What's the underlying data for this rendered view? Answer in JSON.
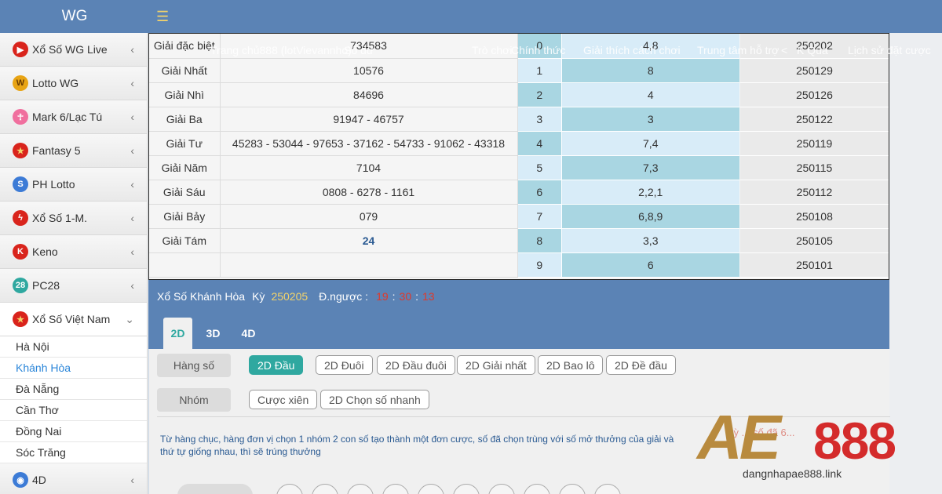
{
  "app": {
    "brand": "WG",
    "menu_icon": "hamburger-icon"
  },
  "nav": [
    "Trang chủ888 (lotVievannho)",
    "Số dư",
    "Trò chơi",
    "Chính thức",
    "Giải thích cách chơi",
    "Trung tâm hỗ trợ",
    "K Qua",
    "Lịch sử đặt cược"
  ],
  "nav_arrow": "<",
  "sidebar": {
    "items": [
      {
        "label": "Xổ Số WG Live",
        "icon": "play-icon",
        "color": "#d9241c"
      },
      {
        "label": "Lotto WG",
        "icon": "w-coin-icon",
        "color": "#e8a414"
      },
      {
        "label": "Mark 6/Lạc Tú",
        "icon": "person-icon",
        "color": "#f06f9e"
      },
      {
        "label": "Fantasy 5",
        "icon": "star-icon",
        "color": "#d9241c"
      },
      {
        "label": "PH Lotto",
        "icon": "swirl-icon",
        "color": "#3c7bd6"
      },
      {
        "label": "Xổ Số 1-M.",
        "icon": "bolt-icon",
        "color": "#d9241c"
      },
      {
        "label": "Keno",
        "icon": "k-icon",
        "color": "#d9241c"
      },
      {
        "label": "PC28",
        "icon": "pc28-icon",
        "color": "#2fa8a0"
      },
      {
        "label": "Xổ Số Việt Nam",
        "icon": "vn-flag-icon",
        "color": "#d9241c"
      }
    ],
    "sub_items": [
      "Hà Nội",
      "Khánh Hòa",
      "Đà Nẵng",
      "Cần Thơ",
      "Đồng Nai",
      "Sóc Trăng"
    ],
    "last_item": {
      "label": "4D",
      "icon": "globe-icon",
      "color": "#3c7bd6"
    },
    "chevron": "‹",
    "chevron_open": "⌄"
  },
  "prizes": [
    {
      "name": "Giải đặc biệt",
      "value": "734583"
    },
    {
      "name": "Giải Nhất",
      "value": "10576"
    },
    {
      "name": "Giải Nhì",
      "value": "84696"
    },
    {
      "name": "Giải Ba",
      "value": "91947 - 46757"
    },
    {
      "name": "Giải Tư",
      "value": "45283 - 53044 - 97653 - 37162 - 54733 - 91062 - 43318"
    },
    {
      "name": "Giải Năm",
      "value": "7104"
    },
    {
      "name": "Giải Sáu",
      "value": "0808 - 6278 - 1161"
    },
    {
      "name": "Giải Bảy",
      "value": "079"
    },
    {
      "name": "Giải Tám",
      "value": "24"
    },
    {
      "name": "",
      "value": ""
    }
  ],
  "heads": [
    {
      "head": "0",
      "tails": "4,8"
    },
    {
      "head": "1",
      "tails": "8"
    },
    {
      "head": "2",
      "tails": "4"
    },
    {
      "head": "3",
      "tails": "3"
    },
    {
      "head": "4",
      "tails": "7,4"
    },
    {
      "head": "5",
      "tails": "7,3"
    },
    {
      "head": "6",
      "tails": "2,2,1"
    },
    {
      "head": "7",
      "tails": "6,8,9"
    },
    {
      "head": "8",
      "tails": "3,3"
    },
    {
      "head": "9",
      "tails": "6"
    }
  ],
  "periods": [
    "250202",
    "250129",
    "250126",
    "250122",
    "250119",
    "250115",
    "250112",
    "250108",
    "250105",
    "250101"
  ],
  "info": {
    "lottery": "Xổ Số Khánh Hòa",
    "period_label": "Kỳ",
    "period": "250205",
    "countdown_label": "Đ.ngược :",
    "hh": "19",
    "mm": "30",
    "ss": "13",
    "sep": ":"
  },
  "tabs": [
    "2D",
    "3D",
    "4D"
  ],
  "bet": {
    "row1_label": "Hàng số",
    "row1_options": [
      "2D Đầu",
      "2D Đuôi",
      "2D Đầu đuôi",
      "2D Giải nhất",
      "2D Bao lô",
      "2D Đề đầu"
    ],
    "row2_label": "Nhóm",
    "row2_options": [
      "Cược xiên",
      "2D Chọn số nhanh"
    ],
    "description": "Từ hàng chục, hàng đơn vị chọn 1 nhóm 2 con số tạo thành một đơn cược, số đã chọn trùng với số mở thưởng của giải và thứ tự giống nhau, thì sẽ trúng thưởng",
    "ghost_text": "kỳ ... số đã 6..."
  },
  "logo": {
    "ae": "AE",
    "num": "888",
    "domain": "dangnhapae888.link"
  },
  "colors": {
    "header": "#5b83b5",
    "accent": "#2fa8a0",
    "countdown": "#e0392b",
    "period": "#f3d36a"
  }
}
